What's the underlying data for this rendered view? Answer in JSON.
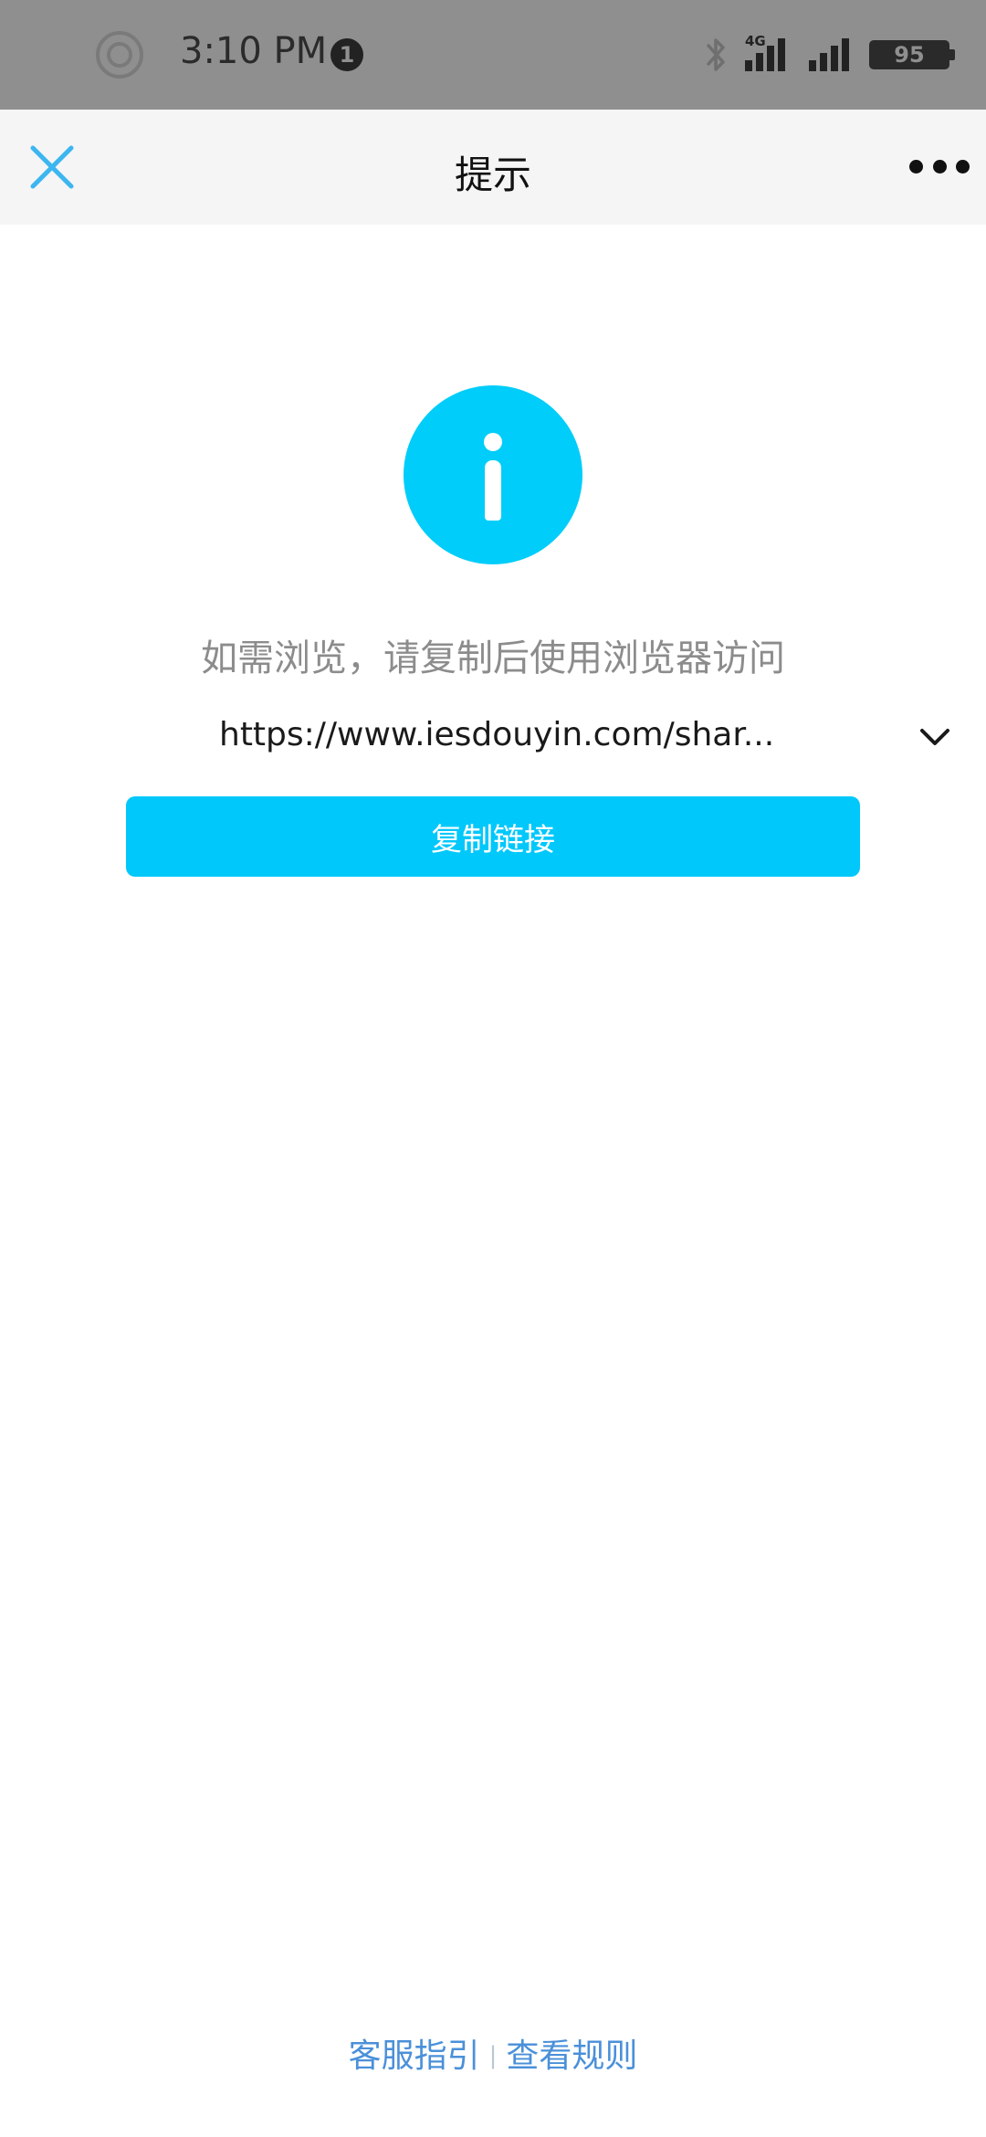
{
  "status_bar": {
    "time": "3:10 PM",
    "notification_count": "1",
    "network_label": "4G",
    "battery": "95"
  },
  "nav": {
    "title": "提示",
    "close_icon": "close-icon",
    "more_icon": "more-icon"
  },
  "main": {
    "icon": "info-icon",
    "hint": "如需浏览，请复制后使用浏览器访问",
    "url": "https://www.iesdouyin.com/shar...",
    "copy_button_label": "复制链接"
  },
  "footer": {
    "service_guide": "客服指引",
    "separator": "|",
    "view_rules": "查看规则"
  },
  "colors": {
    "accent": "#00c8fb",
    "close_icon": "#3cb6f0",
    "link": "#4a90d9",
    "status_bar_bg": "#8f8f8f",
    "nav_bg": "#f5f5f6"
  }
}
